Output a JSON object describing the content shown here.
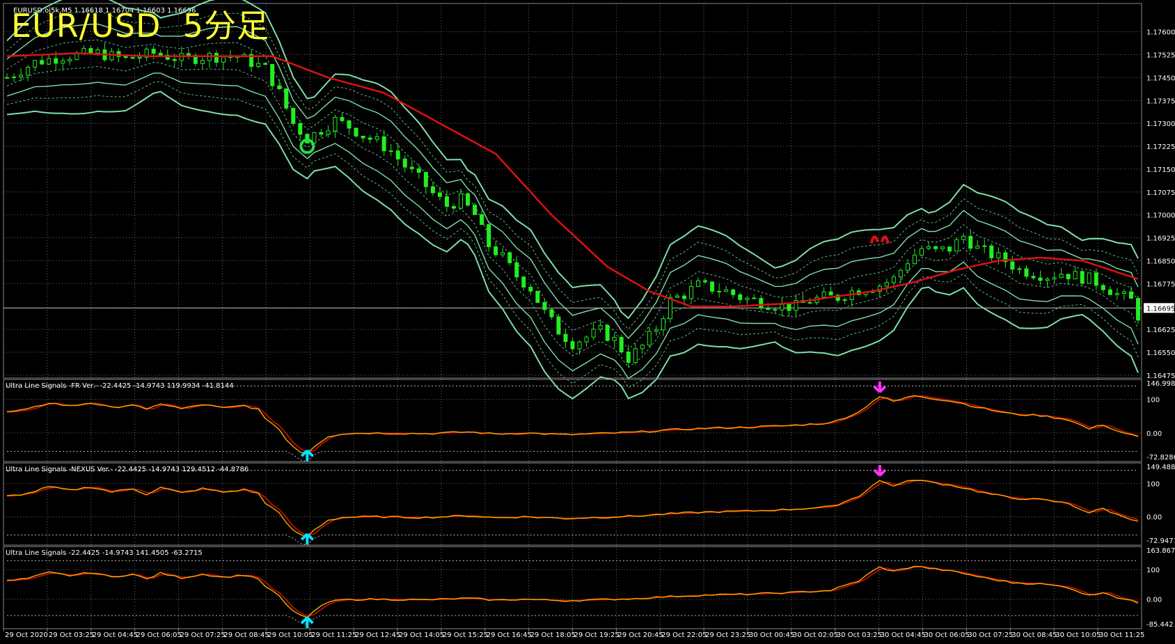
{
  "overlay_title": "EUR/USD  5分足",
  "colors": {
    "background": "#000000",
    "grid": "#b4b4b4",
    "border": "#8a8a8a",
    "axis_text": "#ffffff",
    "candle": "#22ee22",
    "band": "#7fe0a8",
    "band_dashed": "#5fbf86",
    "ma": "#dd1111",
    "osc_main": "#ffaa00",
    "osc_signal": "#cc1100",
    "osc_level": "#bbbbbb",
    "arrow_up": "#00e5ff",
    "arrow_down": "#ff33ff",
    "price_line": "#bcbcbc"
  },
  "chart_data": [
    {
      "type": "candlestick",
      "header": "EURUSD.oj5k,M5  1.16618 1.16704 1.16603 1.16696",
      "price_ticks": [
        "1.17600",
        "1.17525",
        "1.17450",
        "1.17375",
        "1.17300",
        "1.17225",
        "1.17150",
        "1.17075",
        "1.17000",
        "1.16925",
        "1.16850",
        "1.16775",
        "1.16695",
        "1.16625",
        "1.16550",
        "1.16475"
      ],
      "current_price": "1.16695",
      "ylim": [
        1.1647,
        1.1767
      ],
      "price_path": [
        [
          0,
          1.1745
        ],
        [
          4,
          1.175
        ],
        [
          8,
          1.1752
        ],
        [
          13,
          1.1753
        ],
        [
          17,
          1.1751
        ],
        [
          21,
          1.1753
        ],
        [
          25,
          1.1751
        ],
        [
          29,
          1.1752
        ],
        [
          33,
          1.1752
        ],
        [
          37,
          1.1748
        ],
        [
          39,
          1.174
        ],
        [
          41,
          1.173
        ],
        [
          43,
          1.1725
        ],
        [
          45,
          1.1728
        ],
        [
          47,
          1.1731
        ],
        [
          49,
          1.1729
        ],
        [
          51,
          1.1726
        ],
        [
          53,
          1.1724
        ],
        [
          55,
          1.1721
        ],
        [
          57,
          1.1716
        ],
        [
          59,
          1.1712
        ],
        [
          61,
          1.1707
        ],
        [
          63,
          1.1703
        ],
        [
          65,
          1.1705
        ],
        [
          67,
          1.17
        ],
        [
          69,
          1.169
        ],
        [
          71,
          1.1686
        ],
        [
          73,
          1.168
        ],
        [
          75,
          1.1676
        ],
        [
          77,
          1.1668
        ],
        [
          79,
          1.1662
        ],
        [
          81,
          1.1658
        ],
        [
          83,
          1.166
        ],
        [
          85,
          1.1662
        ],
        [
          87,
          1.1659
        ],
        [
          89,
          1.1653
        ],
        [
          91,
          1.1657
        ],
        [
          93,
          1.1663
        ],
        [
          95,
          1.1672
        ],
        [
          97,
          1.1674
        ],
        [
          99,
          1.1677
        ],
        [
          101,
          1.1676
        ],
        [
          103,
          1.1675
        ],
        [
          105,
          1.1673
        ],
        [
          107,
          1.1672
        ],
        [
          109,
          1.1671
        ],
        [
          111,
          1.167
        ],
        [
          113,
          1.167
        ],
        [
          115,
          1.1672
        ],
        [
          117,
          1.1673
        ],
        [
          119,
          1.1673
        ],
        [
          121,
          1.1675
        ],
        [
          123,
          1.1676
        ],
        [
          125,
          1.1677
        ],
        [
          127,
          1.1679
        ],
        [
          129,
          1.1685
        ],
        [
          131,
          1.1689
        ],
        [
          133,
          1.1688
        ],
        [
          135,
          1.1689
        ],
        [
          137,
          1.1693
        ],
        [
          139,
          1.1689
        ],
        [
          141,
          1.1687
        ],
        [
          143,
          1.1685
        ],
        [
          145,
          1.1682
        ],
        [
          147,
          1.1681
        ],
        [
          149,
          1.168
        ],
        [
          151,
          1.1681
        ],
        [
          153,
          1.168
        ],
        [
          155,
          1.1679
        ],
        [
          157,
          1.1677
        ],
        [
          159,
          1.1674
        ],
        [
          161,
          1.1672
        ],
        [
          162,
          1.1667
        ]
      ],
      "ma_path": [
        [
          0,
          1.1752
        ],
        [
          10,
          1.1753
        ],
        [
          20,
          1.1752
        ],
        [
          38,
          1.1752
        ],
        [
          46,
          1.1745
        ],
        [
          54,
          1.174
        ],
        [
          62,
          1.173
        ],
        [
          70,
          1.172
        ],
        [
          78,
          1.17
        ],
        [
          86,
          1.1683
        ],
        [
          92,
          1.1675
        ],
        [
          98,
          1.167
        ],
        [
          104,
          1.167
        ],
        [
          112,
          1.1671
        ],
        [
          118,
          1.1673
        ],
        [
          124,
          1.1675
        ],
        [
          130,
          1.1678
        ],
        [
          136,
          1.1682
        ],
        [
          142,
          1.1685
        ],
        [
          148,
          1.1686
        ],
        [
          154,
          1.1685
        ],
        [
          162,
          1.1679
        ]
      ],
      "band_width": 0.00055,
      "signals": [
        {
          "bar": 43,
          "kind": "green-circle",
          "price": 1.17225
        },
        {
          "bar": 125,
          "kind": "red-marker",
          "price": 1.16925
        }
      ],
      "time_labels": [
        "29 Oct 2020",
        "29 Oct 03:25",
        "29 Oct 04:45",
        "29 Oct 06:05",
        "29 Oct 07:25",
        "29 Oct 08:45",
        "29 Oct 10:05",
        "29 Oct 11:25",
        "29 Oct 12:45",
        "29 Oct 14:05",
        "29 Oct 15:25",
        "29 Oct 16:45",
        "29 Oct 18:05",
        "29 Oct 19:25",
        "29 Oct 20:45",
        "29 Oct 22:05",
        "29 Oct 23:25",
        "30 Oct 00:45",
        "30 Oct 02:05",
        "30 Oct 03:25",
        "30 Oct 04:45",
        "30 Oct 06:05",
        "30 Oct 07:25",
        "30 Oct 08:45",
        "30 Oct 10:05",
        "30 Oct 11:25"
      ]
    },
    {
      "type": "line",
      "header": "Ultra Line Signals -FR Ver.- -22.4425 -14.9743 119.9934 -41.8144",
      "y_ticks": [
        "146.9984",
        "100",
        "0.00",
        "-72.8286"
      ],
      "ylim": [
        -72.8286,
        146.9984
      ],
      "levels": [
        100,
        0
      ],
      "arrows": [
        {
          "bar": 43,
          "dir": "up"
        },
        {
          "bar": 125,
          "dir": "down"
        }
      ]
    },
    {
      "type": "line",
      "header": "Ultra Line Signals -NEXUS Ver.- -22.4425 -14.9743 129.4512 -44.8786",
      "y_ticks": [
        "149.4883",
        "100",
        "0.00",
        "-72.9471"
      ],
      "ylim": [
        -72.9471,
        149.4883
      ],
      "levels": [
        100,
        0
      ],
      "arrows": [
        {
          "bar": 43,
          "dir": "up"
        },
        {
          "bar": 125,
          "dir": "down"
        }
      ]
    },
    {
      "type": "line",
      "header": "Ultra Line Signals -22.4425 -14.9743 141.4505 -63.2715",
      "y_ticks": [
        "163.8674",
        "100",
        "0.00",
        "-85.442"
      ],
      "ylim": [
        -85.442,
        163.8674
      ],
      "levels": [
        100,
        0
      ],
      "arrows": [
        {
          "bar": 43,
          "dir": "up"
        }
      ]
    }
  ],
  "oscillator_path": [
    [
      0,
      62
    ],
    [
      3,
      70
    ],
    [
      6,
      90
    ],
    [
      9,
      80
    ],
    [
      12,
      90
    ],
    [
      15,
      75
    ],
    [
      18,
      85
    ],
    [
      20,
      68
    ],
    [
      22,
      88
    ],
    [
      25,
      72
    ],
    [
      28,
      85
    ],
    [
      31,
      74
    ],
    [
      34,
      82
    ],
    [
      36,
      70
    ],
    [
      37,
      40
    ],
    [
      38,
      30
    ],
    [
      39,
      10
    ],
    [
      40,
      -20
    ],
    [
      41,
      -40
    ],
    [
      42,
      -55
    ],
    [
      43,
      -60
    ],
    [
      44,
      -40
    ],
    [
      46,
      -10
    ],
    [
      48,
      -2
    ],
    [
      52,
      0
    ],
    [
      60,
      -2
    ],
    [
      66,
      3
    ],
    [
      70,
      -3
    ],
    [
      74,
      0
    ],
    [
      80,
      -5
    ],
    [
      90,
      2
    ],
    [
      94,
      8
    ],
    [
      100,
      14
    ],
    [
      106,
      17
    ],
    [
      112,
      22
    ],
    [
      118,
      30
    ],
    [
      122,
      62
    ],
    [
      124,
      95
    ],
    [
      125,
      108
    ],
    [
      127,
      94
    ],
    [
      130,
      112
    ],
    [
      132,
      105
    ],
    [
      136,
      92
    ],
    [
      140,
      72
    ],
    [
      144,
      56
    ],
    [
      148,
      52
    ],
    [
      152,
      40
    ],
    [
      155,
      12
    ],
    [
      157,
      25
    ],
    [
      159,
      6
    ],
    [
      161,
      -6
    ],
    [
      162,
      -12
    ]
  ]
}
